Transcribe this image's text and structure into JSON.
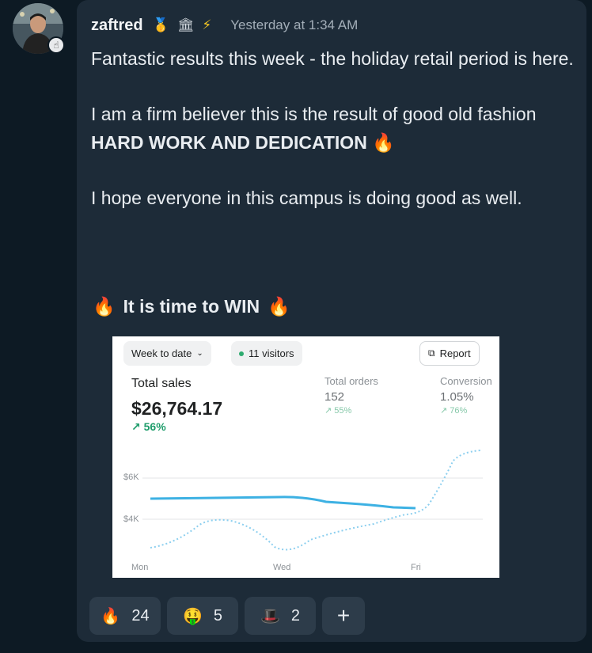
{
  "message": {
    "username": "zaftred",
    "badges": [
      "medal-icon",
      "bank-icon",
      "lightning-icon"
    ],
    "timestamp": "Yesterday at 1:34 AM",
    "line1": "Fantastic results this week - the holiday retail period is here.",
    "line2_plain": "I am a firm believer this is the result of good old fashion ",
    "line2_bold": "HARD WORK AND DEDICATION",
    "line3": "I hope everyone in this campus is doing good as well.",
    "win_text": "It is time to WIN"
  },
  "screenshot": {
    "period": "Week to date",
    "visitors": "11 visitors",
    "report": "Report",
    "total_sales_label": "Total sales",
    "total_sales_value": "$26,764.17",
    "total_sales_change": "56%",
    "orders_label": "Total orders",
    "orders_value": "152",
    "orders_change": "55%",
    "conversion_label": "Conversion",
    "conversion_value": "1.05%",
    "conversion_change": "76%",
    "y_labels": [
      "$6K",
      "$4K"
    ],
    "x_labels": [
      "Mon",
      "Wed",
      "Fri"
    ],
    "colors": {
      "current": "#3db1e3",
      "previous": "#8ccfef",
      "positive": "#1d9c6a"
    }
  },
  "reactions": [
    {
      "icon": "fire-icon",
      "count": "24"
    },
    {
      "icon": "money-mouth-face-icon",
      "count": "5"
    },
    {
      "icon": "top-hat-icon",
      "count": "2"
    }
  ],
  "add_reaction": "+"
}
